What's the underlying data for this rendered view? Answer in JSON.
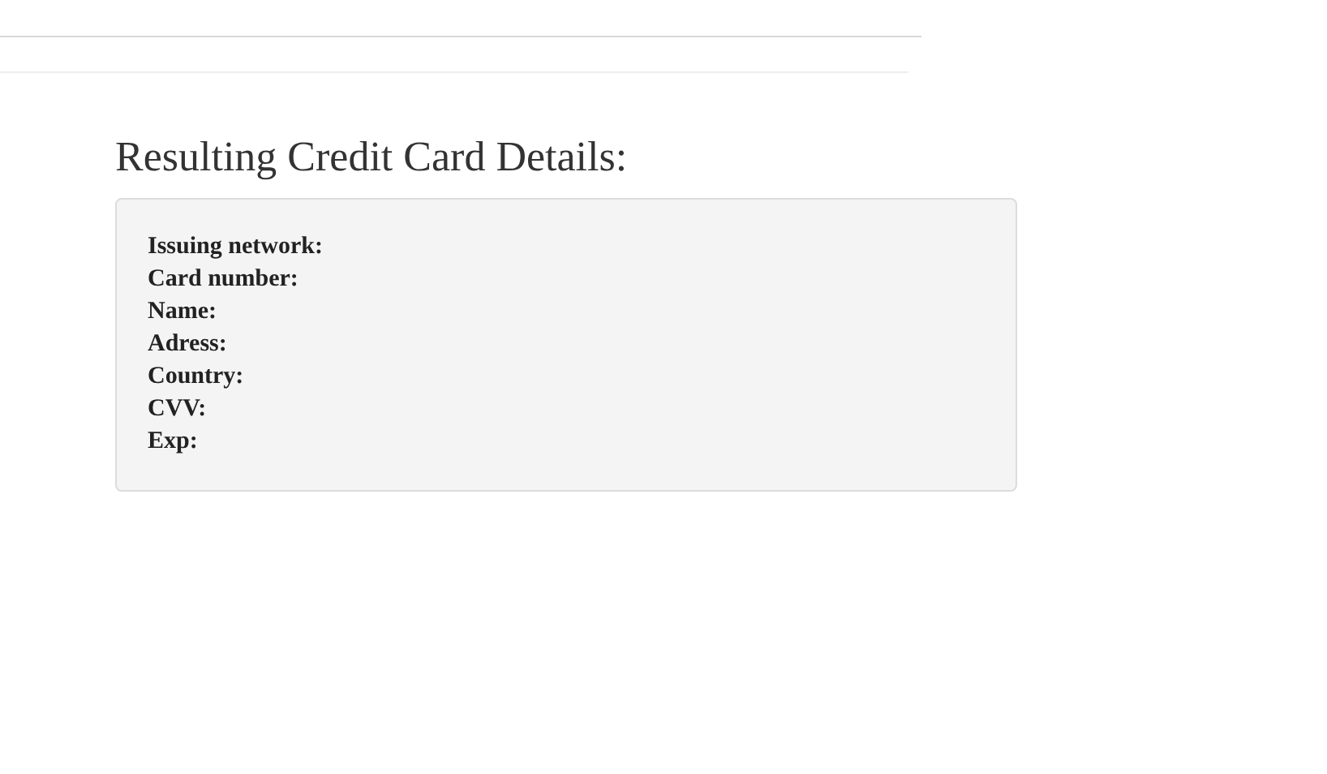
{
  "title": "Resulting Credit Card Details:",
  "fields": [
    {
      "label": "Issuing network:"
    },
    {
      "label": "Card number:"
    },
    {
      "label": "Name:"
    },
    {
      "label": "Adress:"
    },
    {
      "label": "Country:"
    },
    {
      "label": "CVV:"
    },
    {
      "label": "Exp:"
    }
  ]
}
